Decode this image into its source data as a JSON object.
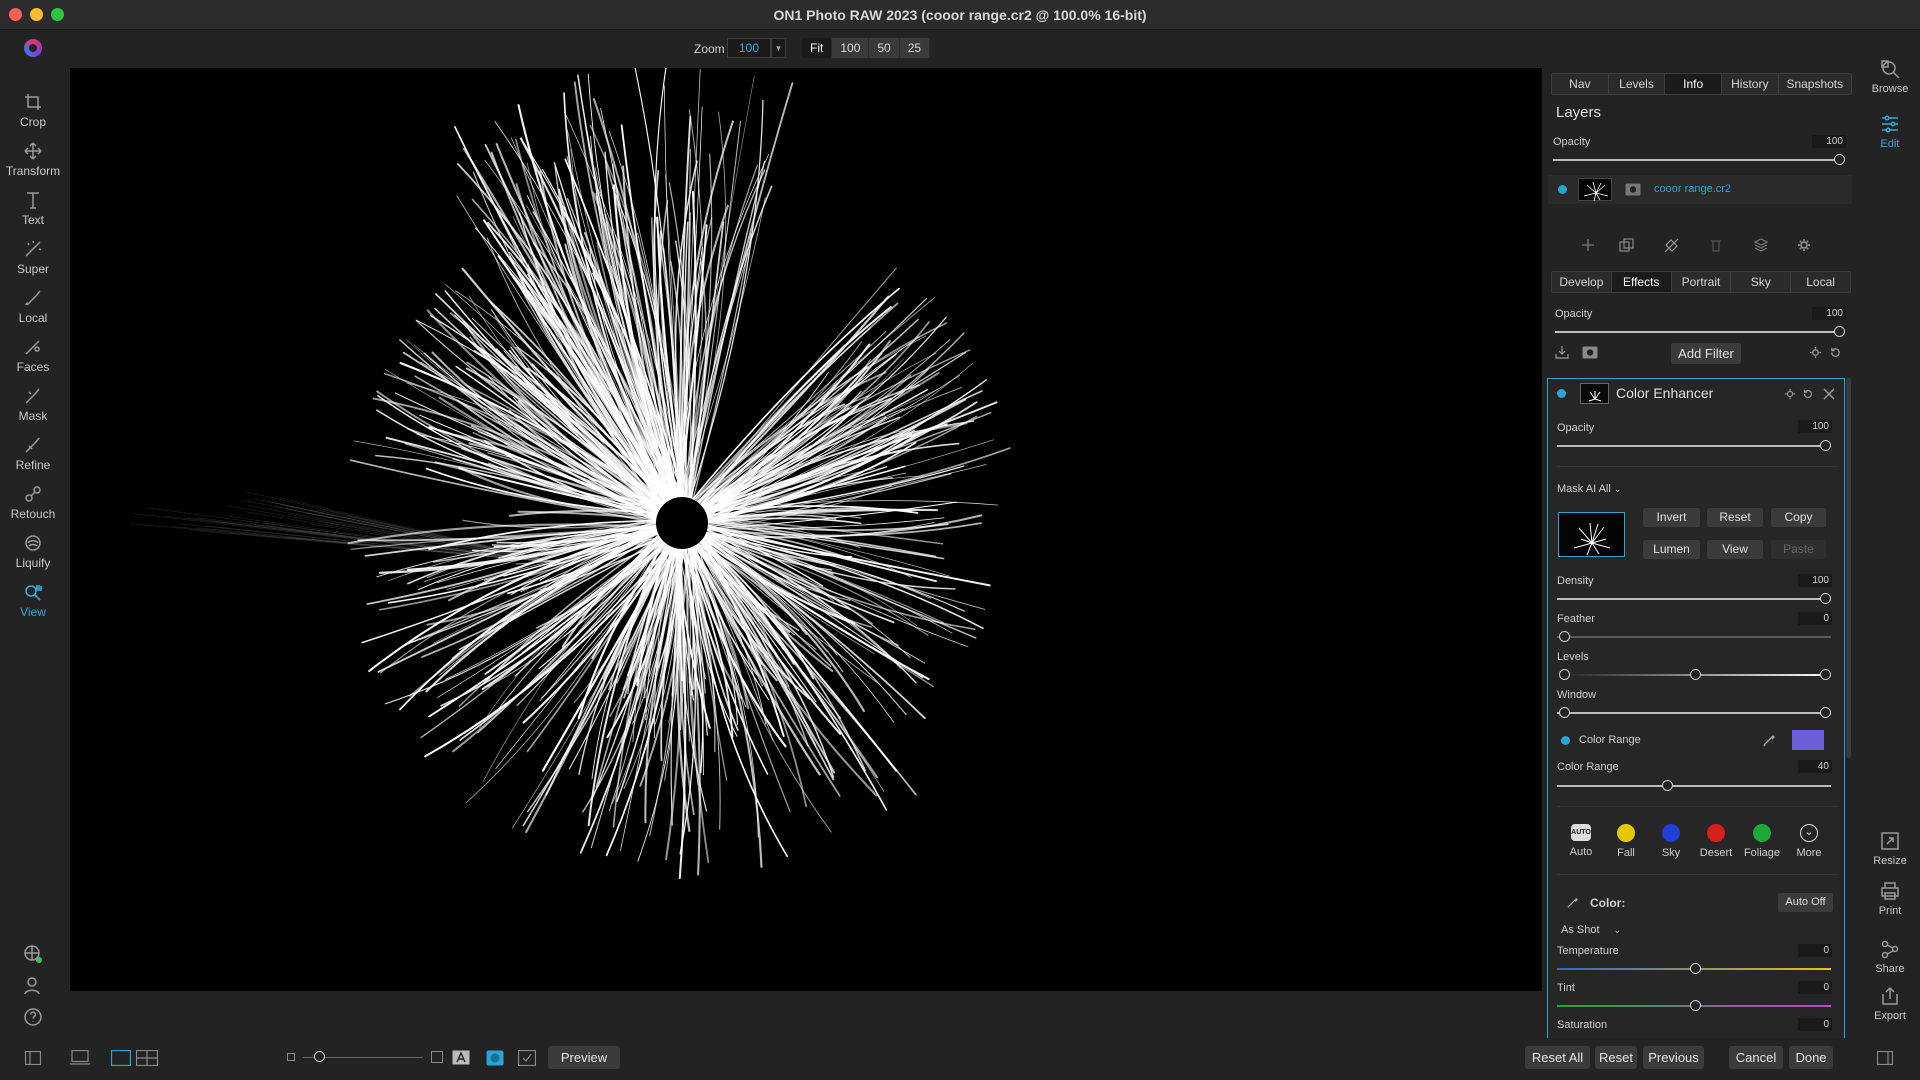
{
  "window": {
    "title": "ON1 Photo RAW 2023 (cooor range.cr2 @ 100.0% 16-bit)"
  },
  "toolbar": {
    "zoom_label": "Zoom",
    "zoom_value": "100",
    "zoom_presets": [
      "Fit",
      "100",
      "50",
      "25"
    ]
  },
  "left_tools": [
    {
      "label": "Crop",
      "icon": "crop-icon"
    },
    {
      "label": "Transform",
      "icon": "move-icon"
    },
    {
      "label": "Text",
      "icon": "text-icon"
    },
    {
      "label": "Super",
      "icon": "super-brush-icon"
    },
    {
      "label": "Local",
      "icon": "brush-icon"
    },
    {
      "label": "Faces",
      "icon": "faces-icon"
    },
    {
      "label": "Mask",
      "icon": "mask-brush-icon"
    },
    {
      "label": "Refine",
      "icon": "refine-brush-icon"
    },
    {
      "label": "Retouch",
      "icon": "retouch-icon"
    },
    {
      "label": "Liquify",
      "icon": "liquify-icon"
    },
    {
      "label": "View",
      "icon": "view-hand-icon",
      "active": true
    }
  ],
  "panel": {
    "top_tabs": [
      "Nav",
      "Levels",
      "Info",
      "History",
      "Snapshots"
    ],
    "top_tab_active": "Info",
    "layers": {
      "title": "Layers",
      "opacity_label": "Opacity",
      "opacity_value": "100",
      "layer_name": "cooor range.cr2"
    },
    "edit_tabs": [
      "Develop",
      "Effects",
      "Portrait",
      "Sky",
      "Local"
    ],
    "edit_tab_active": "Effects",
    "effects_opacity_label": "Opacity",
    "effects_opacity_value": "100",
    "add_filter": "Add Filter",
    "filter": {
      "name": "Color Enhancer",
      "opacity_label": "Opacity",
      "opacity_value": "100",
      "mask_label": "Mask AI All",
      "mask_buttons": [
        "Invert",
        "Reset",
        "Copy",
        "Lumen",
        "View",
        "Paste"
      ],
      "density_label": "Density",
      "density_value": "100",
      "feather_label": "Feather",
      "feather_value": "0",
      "levels_label": "Levels",
      "window_label": "Window",
      "color_range_toggle": "Color Range",
      "color_range_swatch": "#6a5fd8",
      "color_range_label": "Color Range",
      "color_range_value": "40",
      "presets": [
        {
          "label": "Auto",
          "color": "#ffffff"
        },
        {
          "label": "Fall",
          "color": "#e3c800"
        },
        {
          "label": "Sky",
          "color": "#1f3fd8"
        },
        {
          "label": "Desert",
          "color": "#d61f1f"
        },
        {
          "label": "Foliage",
          "color": "#1fa83a"
        },
        {
          "label": "More",
          "color": "#ffffff"
        }
      ],
      "color_label": "Color:",
      "auto_off": "Auto Off",
      "white_balance": "As Shot",
      "temperature_label": "Temperature",
      "temperature_value": "0",
      "tint_label": "Tint",
      "tint_value": "0",
      "saturation_label": "Saturation",
      "saturation_value": "0"
    }
  },
  "modules": [
    {
      "label": "Browse",
      "icon": "browse-icon"
    },
    {
      "label": "Edit",
      "icon": "edit-sliders-icon",
      "active": true
    },
    {
      "label": "Resize",
      "icon": "resize-icon"
    },
    {
      "label": "Print",
      "icon": "print-icon"
    },
    {
      "label": "Share",
      "icon": "share-icon"
    },
    {
      "label": "Export",
      "icon": "export-icon"
    }
  ],
  "bottom": {
    "preview": "Preview",
    "reset_all": "Reset All",
    "reset": "Reset",
    "previous": "Previous",
    "cancel": "Cancel",
    "done": "Done"
  },
  "accent_color": "#2aa4d5"
}
